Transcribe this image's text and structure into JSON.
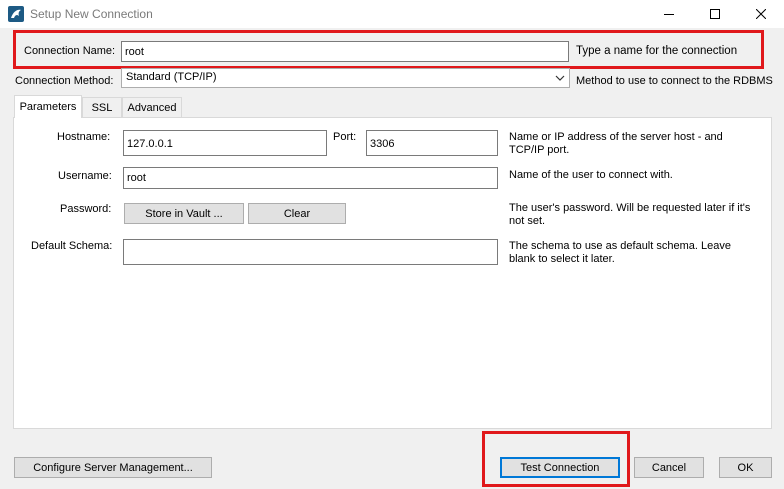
{
  "window": {
    "title": "Setup New Connection",
    "icon": "mysql-dolphin-icon",
    "controls": [
      "minimize-icon",
      "maximize-icon",
      "close-icon"
    ]
  },
  "connection_name": {
    "label": "Connection Name:",
    "value": "root",
    "hint": "Type a name for the connection"
  },
  "connection_method": {
    "label": "Connection Method:",
    "value": "Standard (TCP/IP)",
    "hint": "Method to use to connect to the RDBMS"
  },
  "tabs": [
    {
      "label": "Parameters",
      "active": true
    },
    {
      "label": "SSL",
      "active": false
    },
    {
      "label": "Advanced",
      "active": false
    }
  ],
  "parameters": {
    "hostname": {
      "label": "Hostname:",
      "value": "127.0.0.1"
    },
    "port": {
      "label": "Port:",
      "value": "3306"
    },
    "hostname_hint": "Name or IP address of the server host - and TCP/IP port.",
    "username": {
      "label": "Username:",
      "value": "root",
      "hint": "Name of the user to connect with."
    },
    "password": {
      "label": "Password:",
      "store_button": "Store in Vault ...",
      "clear_button": "Clear",
      "hint": "The user's password. Will be requested later if it's not set."
    },
    "default_schema": {
      "label": "Default Schema:",
      "value": "",
      "hint": "The schema to use as default schema. Leave blank to select it later."
    }
  },
  "footer": {
    "configure_button": "Configure Server Management...",
    "test_button": "Test Connection",
    "cancel_button": "Cancel",
    "ok_button": "OK"
  },
  "highlight_color": "#e0181b"
}
